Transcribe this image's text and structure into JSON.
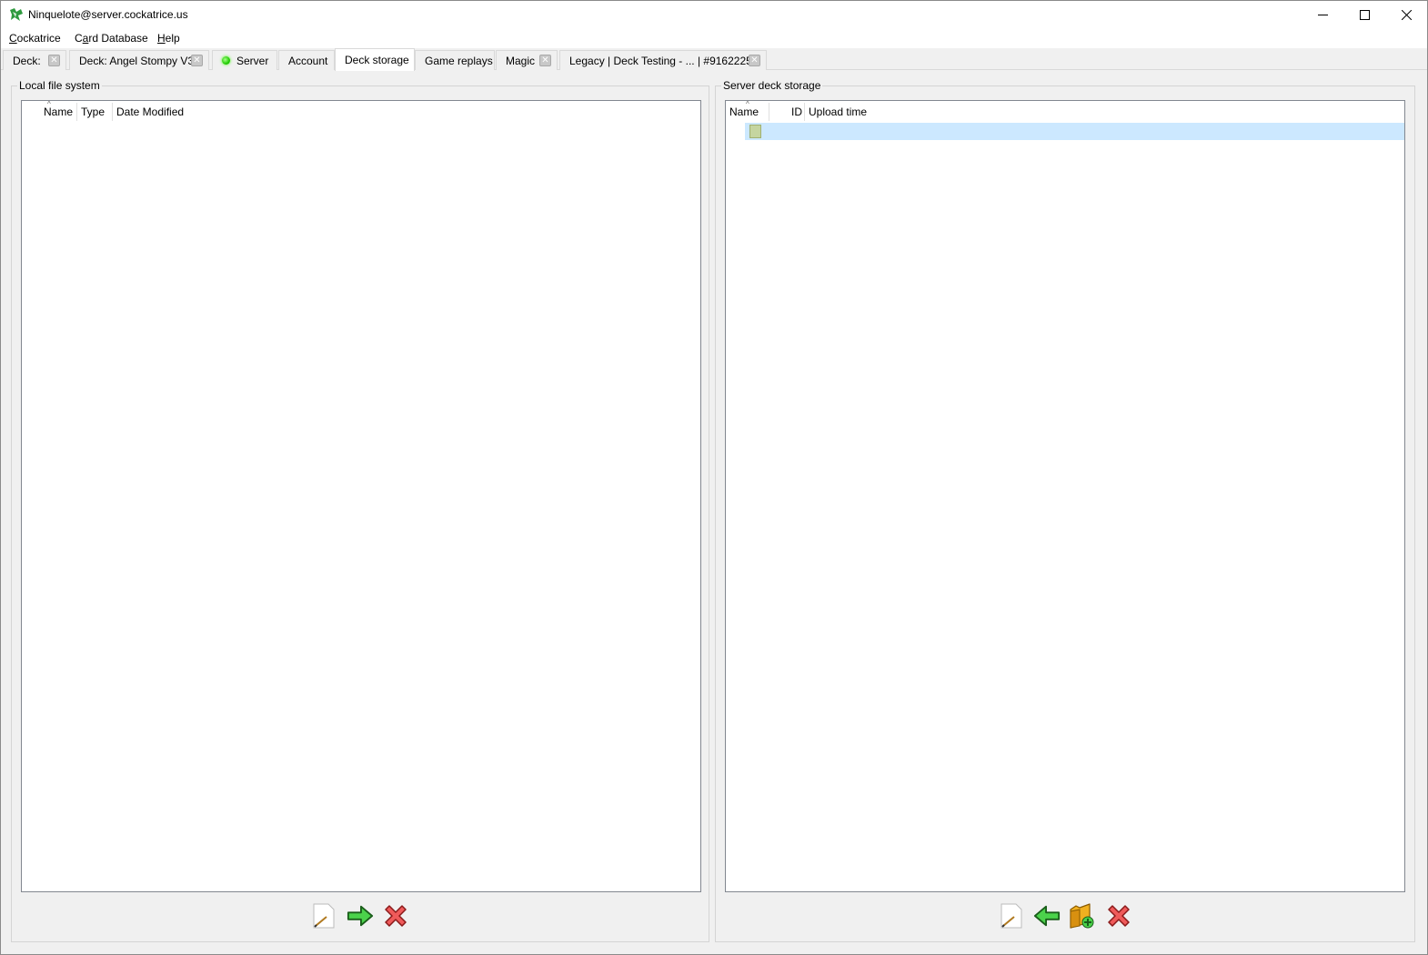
{
  "window": {
    "title": "Ninquelote@server.cockatrice.us",
    "controls": [
      "minimize",
      "maximize",
      "close"
    ]
  },
  "menu": [
    {
      "label": "Cockatrice",
      "mnemonic": "C",
      "rest": "ockatrice"
    },
    {
      "label": "Card Database",
      "mnemonic": "a",
      "pre": "C",
      "rest": "rd Database"
    },
    {
      "label": "Help",
      "mnemonic": "H",
      "rest": "elp"
    }
  ],
  "tabs": [
    {
      "label": "Deck:",
      "closable": true
    },
    {
      "label": "Deck: Angel Stompy V3",
      "closable": true
    },
    {
      "label": "Server",
      "closable": false,
      "status": "connected"
    },
    {
      "label": "Account",
      "closable": false
    },
    {
      "label": "Deck storage",
      "closable": false,
      "active": true
    },
    {
      "label": "Game replays",
      "closable": false
    },
    {
      "label": "Magic",
      "closable": true
    },
    {
      "label": "Legacy | Deck Testing - ... | #9162225",
      "closable": true
    }
  ],
  "local_panel": {
    "title": "Local file system",
    "columns": [
      "Name",
      "Type",
      "Date Modified"
    ],
    "rows": []
  },
  "server_panel": {
    "title": "Server deck storage",
    "columns": [
      "Name",
      "ID",
      "Upload time"
    ],
    "rows": [
      {
        "name": "",
        "id": "",
        "upload_time": "",
        "icon": "folder-icon",
        "selected": true
      }
    ]
  },
  "local_toolbar": [
    "open-deck-icon",
    "upload-arrow-icon",
    "delete-icon"
  ],
  "server_toolbar": [
    "open-deck-icon",
    "download-arrow-icon",
    "new-folder-icon",
    "delete-icon"
  ]
}
